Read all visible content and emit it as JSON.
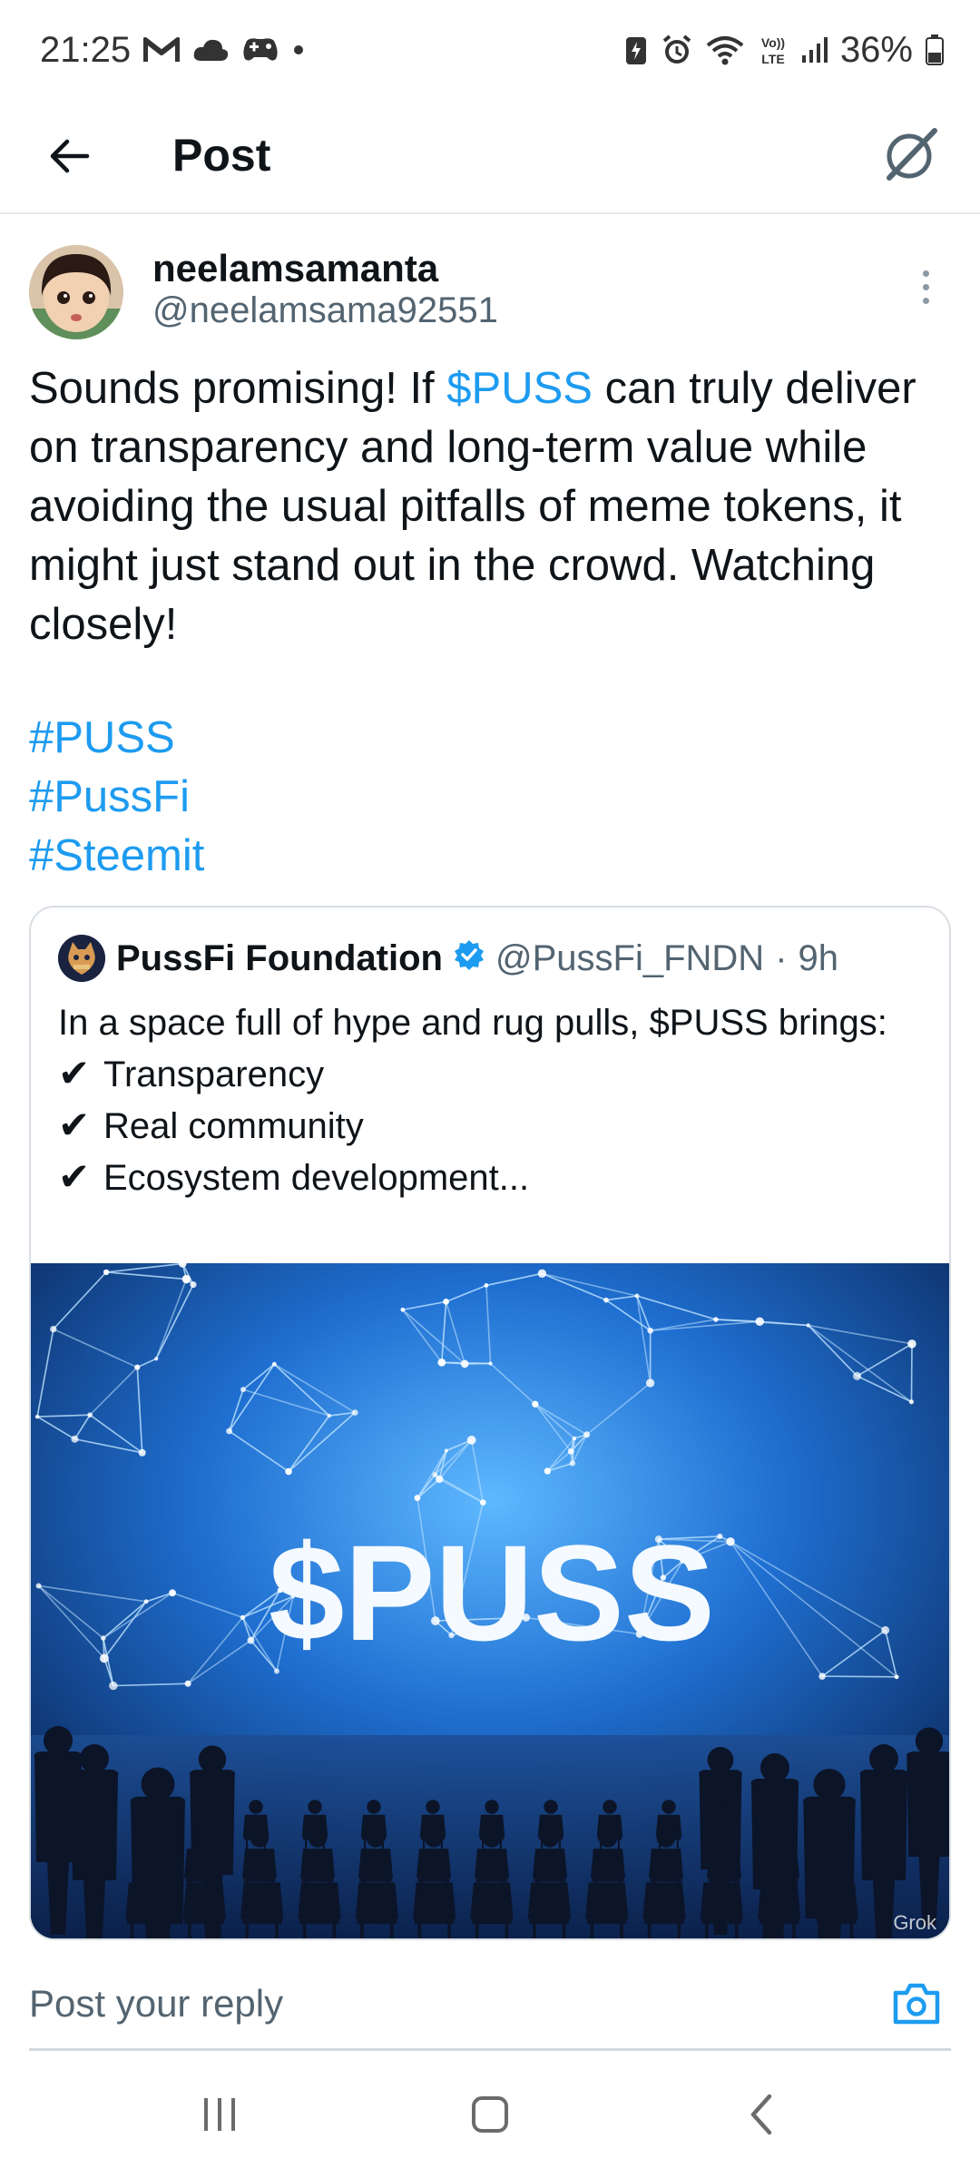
{
  "status_bar": {
    "time": "21:25",
    "battery": "36%",
    "left_icons": [
      "gmail-icon",
      "cloud-icon",
      "game-controller-icon",
      "dot-icon"
    ],
    "right_icons": [
      "battery-saver-icon",
      "alarm-icon",
      "wifi-icon",
      "volte-icon",
      "signal-icon",
      "battery-icon"
    ]
  },
  "header": {
    "title": "Post"
  },
  "post": {
    "author_name": "neelamsamanta",
    "author_handle": "@neelamsama92551",
    "text_before_link": "Sounds promising! If ",
    "cashtag": "$PUSS",
    "text_after_link": " can truly deliver on transparency and long-term value while avoiding the usual pitfalls of meme tokens, it might just stand out in the crowd. Watching closely!",
    "hashtags": [
      "#PUSS",
      "#PussFi",
      "#Steemit"
    ]
  },
  "quote": {
    "author_name": "PussFi Foundation",
    "author_handle": "@PussFi_FNDN",
    "separator": "·",
    "time": "9h",
    "intro": "In a space full of hype and rug pulls, $PUSS brings:",
    "bullets": [
      "Transparency",
      "Real community",
      "Ecosystem development..."
    ],
    "check_glyph": "✔",
    "image_text": "$PUSS",
    "image_watermark": "Grok"
  },
  "reply_bar": {
    "placeholder": "Post your reply"
  },
  "colors": {
    "accent": "#1d9bf0",
    "text": "#0f1419",
    "muted": "#536471",
    "verified": "#1d9bf0"
  }
}
